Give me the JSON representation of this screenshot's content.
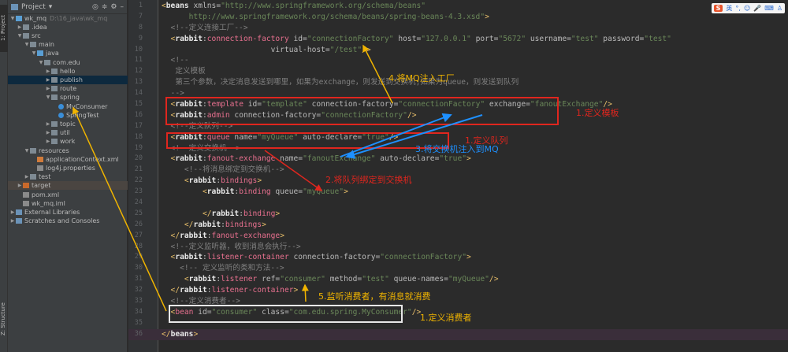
{
  "left_strip": {
    "project_tab": "1: Project",
    "structure_tab": "Z: Structure"
  },
  "sidebar": {
    "title": "Project",
    "tree": [
      {
        "label": "wk_mq",
        "hint": "D:\\16_java\\wk_mq",
        "depth": 0,
        "arrow": "▼",
        "icon": "src"
      },
      {
        "label": ".idea",
        "depth": 1,
        "arrow": "▶",
        "icon": "folder"
      },
      {
        "label": "src",
        "depth": 1,
        "arrow": "▼",
        "icon": "folder"
      },
      {
        "label": "main",
        "depth": 2,
        "arrow": "▼",
        "icon": "folder"
      },
      {
        "label": "java",
        "depth": 3,
        "arrow": "▼",
        "icon": "src"
      },
      {
        "label": "com.edu",
        "depth": 4,
        "arrow": "▼",
        "icon": "folder"
      },
      {
        "label": "hello",
        "depth": 5,
        "arrow": "▶",
        "icon": "folder"
      },
      {
        "label": "publish",
        "depth": 5,
        "arrow": "▶",
        "icon": "folder",
        "selected": true
      },
      {
        "label": "route",
        "depth": 5,
        "arrow": "▶",
        "icon": "folder"
      },
      {
        "label": "spring",
        "depth": 5,
        "arrow": "▼",
        "icon": "folder"
      },
      {
        "label": "MyConsumer",
        "depth": 6,
        "arrow": "",
        "icon": "cls"
      },
      {
        "label": "SpringTest",
        "depth": 6,
        "arrow": "",
        "icon": "cls"
      },
      {
        "label": "topic",
        "depth": 5,
        "arrow": "▶",
        "icon": "folder"
      },
      {
        "label": "util",
        "depth": 5,
        "arrow": "▶",
        "icon": "folder"
      },
      {
        "label": "work",
        "depth": 5,
        "arrow": "▶",
        "icon": "folder"
      },
      {
        "label": "resources",
        "depth": 2,
        "arrow": "▼",
        "icon": "folder"
      },
      {
        "label": "applicationContext.xml",
        "depth": 3,
        "arrow": "",
        "icon": "xml"
      },
      {
        "label": "log4j.properties",
        "depth": 3,
        "arrow": "",
        "icon": "file"
      },
      {
        "label": "test",
        "depth": 2,
        "arrow": "▶",
        "icon": "folder"
      },
      {
        "label": "target",
        "depth": 1,
        "arrow": "▶",
        "icon": "orange",
        "target": true
      },
      {
        "label": "pom.xml",
        "depth": 1,
        "arrow": "",
        "icon": "file"
      },
      {
        "label": "wk_mq.iml",
        "depth": 1,
        "arrow": "",
        "icon": "file"
      },
      {
        "label": "External Libraries",
        "depth": 0,
        "arrow": "▶",
        "icon": "lib"
      },
      {
        "label": "Scratches and Consoles",
        "depth": 0,
        "arrow": "▶",
        "icon": "lib"
      }
    ]
  },
  "ime": {
    "logo": "S",
    "lang": "英"
  },
  "code": [
    {
      "n": "1",
      "t": [
        [
          "br",
          "<"
        ],
        [
          "tag",
          "beans"
        ],
        [
          "attr",
          " xmlns="
        ],
        [
          "val",
          "\"http://www.springframework.org/schema/beans\""
        ]
      ]
    },
    {
      "n": "7",
      "t": [
        [
          "p",
          "      "
        ],
        [
          "val",
          "http://www.springframework.org/schema/beans/spring-beans-4.3.xsd\""
        ],
        [
          "br",
          ">"
        ]
      ]
    },
    {
      "n": "8",
      "t": [
        [
          "cm",
          "  <!--定义连接工厂-->"
        ]
      ]
    },
    {
      "n": "9",
      "t": [
        [
          "br",
          "  <"
        ],
        [
          "tag",
          "rabbit"
        ],
        [
          "p",
          ":"
        ],
        [
          "name",
          "connection-factory"
        ],
        [
          "attr",
          " id="
        ],
        [
          "val",
          "\"connectionFactory\""
        ],
        [
          "attr",
          " host="
        ],
        [
          "val",
          "\"127.0.0.1\""
        ],
        [
          "attr",
          " port="
        ],
        [
          "val",
          "\"5672\""
        ],
        [
          "attr",
          " username="
        ],
        [
          "val",
          "\"test\""
        ],
        [
          "attr",
          " password="
        ],
        [
          "val",
          "\"test\""
        ]
      ]
    },
    {
      "n": "10",
      "t": [
        [
          "attr",
          "                        virtual-host="
        ],
        [
          "val",
          "\"/test\""
        ],
        [
          "br",
          "/>"
        ]
      ]
    },
    {
      "n": "11",
      "t": [
        [
          "cm",
          "  <!--"
        ]
      ]
    },
    {
      "n": "12",
      "t": [
        [
          "cm",
          "   定义模板"
        ]
      ]
    },
    {
      "n": "13",
      "t": [
        [
          "cm",
          "   第三个参数，决定消息发送到哪里，如果为exchange，则发送到交换机;如果为queue，则发送到队列"
        ]
      ]
    },
    {
      "n": "14",
      "t": [
        [
          "cm",
          "  -->"
        ]
      ]
    },
    {
      "n": "15",
      "t": [
        [
          "br",
          "  <"
        ],
        [
          "tag",
          "rabbit"
        ],
        [
          "p",
          ":"
        ],
        [
          "name",
          "template"
        ],
        [
          "attr",
          " id="
        ],
        [
          "val",
          "\"template\""
        ],
        [
          "attr",
          " connection-factory="
        ],
        [
          "val",
          "\"connectionFactory\""
        ],
        [
          "attr",
          " exchange="
        ],
        [
          "val",
          "\"fanoutExchange\""
        ],
        [
          "br",
          "/>"
        ]
      ]
    },
    {
      "n": "16",
      "t": [
        [
          "br",
          "  <"
        ],
        [
          "tag",
          "rabbit"
        ],
        [
          "p",
          ":"
        ],
        [
          "name",
          "admin"
        ],
        [
          "attr",
          " connection-factory="
        ],
        [
          "val",
          "\"connectionFactory\""
        ],
        [
          "br",
          "/>"
        ]
      ]
    },
    {
      "n": "17",
      "t": [
        [
          "cm",
          "  <!--定义队列-->"
        ]
      ]
    },
    {
      "n": "18",
      "t": [
        [
          "br",
          "  <"
        ],
        [
          "tag",
          "rabbit"
        ],
        [
          "p",
          ":"
        ],
        [
          "name",
          "queue"
        ],
        [
          "attr",
          " name="
        ],
        [
          "val",
          "\"myQueue\""
        ],
        [
          "attr",
          " auto-declare="
        ],
        [
          "val",
          "\"true\""
        ],
        [
          "br",
          "/>"
        ]
      ]
    },
    {
      "n": "19",
      "t": [
        [
          "cm",
          "  <!--定义交换机-->"
        ]
      ]
    },
    {
      "n": "20",
      "t": [
        [
          "br",
          "  <"
        ],
        [
          "tag",
          "rabbit"
        ],
        [
          "p",
          ":"
        ],
        [
          "name",
          "fanout-exchange"
        ],
        [
          "attr",
          " name="
        ],
        [
          "val",
          "\"fanoutExchange\""
        ],
        [
          "attr",
          " auto-declare="
        ],
        [
          "val",
          "\"true\""
        ],
        [
          "br",
          ">"
        ]
      ]
    },
    {
      "n": "21",
      "t": [
        [
          "cm",
          "     <!--将消息绑定到交换机-->"
        ]
      ]
    },
    {
      "n": "22",
      "t": [
        [
          "br",
          "     <"
        ],
        [
          "tag",
          "rabbit"
        ],
        [
          "p",
          ":"
        ],
        [
          "name",
          "bindings"
        ],
        [
          "br",
          ">"
        ]
      ]
    },
    {
      "n": "23",
      "t": [
        [
          "br",
          "         <"
        ],
        [
          "tag",
          "rabbit"
        ],
        [
          "p",
          ":"
        ],
        [
          "name",
          "binding"
        ],
        [
          "attr",
          " queue="
        ],
        [
          "val",
          "\"myQueue\""
        ],
        [
          "br",
          ">"
        ]
      ]
    },
    {
      "n": "24",
      "t": []
    },
    {
      "n": "25",
      "t": [
        [
          "br",
          "         </"
        ],
        [
          "tag",
          "rabbit"
        ],
        [
          "p",
          ":"
        ],
        [
          "name",
          "binding"
        ],
        [
          "br",
          ">"
        ]
      ]
    },
    {
      "n": "26",
      "t": [
        [
          "br",
          "     </"
        ],
        [
          "tag",
          "rabbit"
        ],
        [
          "p",
          ":"
        ],
        [
          "name",
          "bindings"
        ],
        [
          "br",
          ">"
        ]
      ]
    },
    {
      "n": "27",
      "t": [
        [
          "br",
          "  </"
        ],
        [
          "tag",
          "rabbit"
        ],
        [
          "p",
          ":"
        ],
        [
          "name",
          "fanout-exchange"
        ],
        [
          "br",
          ">"
        ]
      ]
    },
    {
      "n": "28",
      "t": [
        [
          "cm",
          "  <!--定义监听器，收到消息会执行-->"
        ]
      ]
    },
    {
      "n": "29",
      "t": [
        [
          "br",
          "  <"
        ],
        [
          "tag",
          "rabbit"
        ],
        [
          "p",
          ":"
        ],
        [
          "name",
          "listener-container"
        ],
        [
          "attr",
          " connection-factory="
        ],
        [
          "val",
          "\"connectionFactory\""
        ],
        [
          "br",
          ">"
        ]
      ]
    },
    {
      "n": "30",
      "t": [
        [
          "cm",
          "    <!-- 定义监听的类和方法-->"
        ]
      ]
    },
    {
      "n": "31",
      "t": [
        [
          "br",
          "     <"
        ],
        [
          "tag",
          "rabbit"
        ],
        [
          "p",
          ":"
        ],
        [
          "name",
          "listener"
        ],
        [
          "attr",
          " ref="
        ],
        [
          "val",
          "\"consumer\""
        ],
        [
          "attr",
          " method="
        ],
        [
          "val",
          "\"test\""
        ],
        [
          "attr",
          " queue-names="
        ],
        [
          "val",
          "\"myQueue\""
        ],
        [
          "br",
          "/>"
        ]
      ]
    },
    {
      "n": "32",
      "t": [
        [
          "br",
          "  </"
        ],
        [
          "tag",
          "rabbit"
        ],
        [
          "p",
          ":"
        ],
        [
          "name",
          "listener-container"
        ],
        [
          "br",
          ">"
        ]
      ]
    },
    {
      "n": "33",
      "t": [
        [
          "cm",
          "  <!--定义消费者-->"
        ]
      ]
    },
    {
      "n": "34",
      "t": [
        [
          "br",
          "  <"
        ],
        [
          "name",
          "bean"
        ],
        [
          "attr",
          " id="
        ],
        [
          "val",
          "\"consumer\""
        ],
        [
          "attr",
          " class="
        ],
        [
          "val",
          "\"com.edu.spring.MyConsumer\""
        ],
        [
          "br",
          "/>"
        ]
      ]
    },
    {
      "n": "35",
      "t": []
    },
    {
      "n": "36",
      "t": [
        [
          "br",
          "</"
        ],
        [
          "tag",
          "beans"
        ],
        [
          "br",
          ">"
        ]
      ],
      "current": true
    }
  ],
  "annotations": {
    "define_template": "1.定义模板",
    "define_queue": "1.定义队列",
    "inject_exchange": "3.将交换机注入到MQ",
    "inject_factory": "4.将MQ注入工厂",
    "bind_queue": "2.将队列绑定到交换机",
    "listen_consumer": "5.监听消费者，有消息就消费",
    "define_consumer": "1.定义消费者"
  },
  "colors": {
    "red": "#e0261e",
    "yellow": "#f0b400",
    "blue": "#1e90ff"
  }
}
